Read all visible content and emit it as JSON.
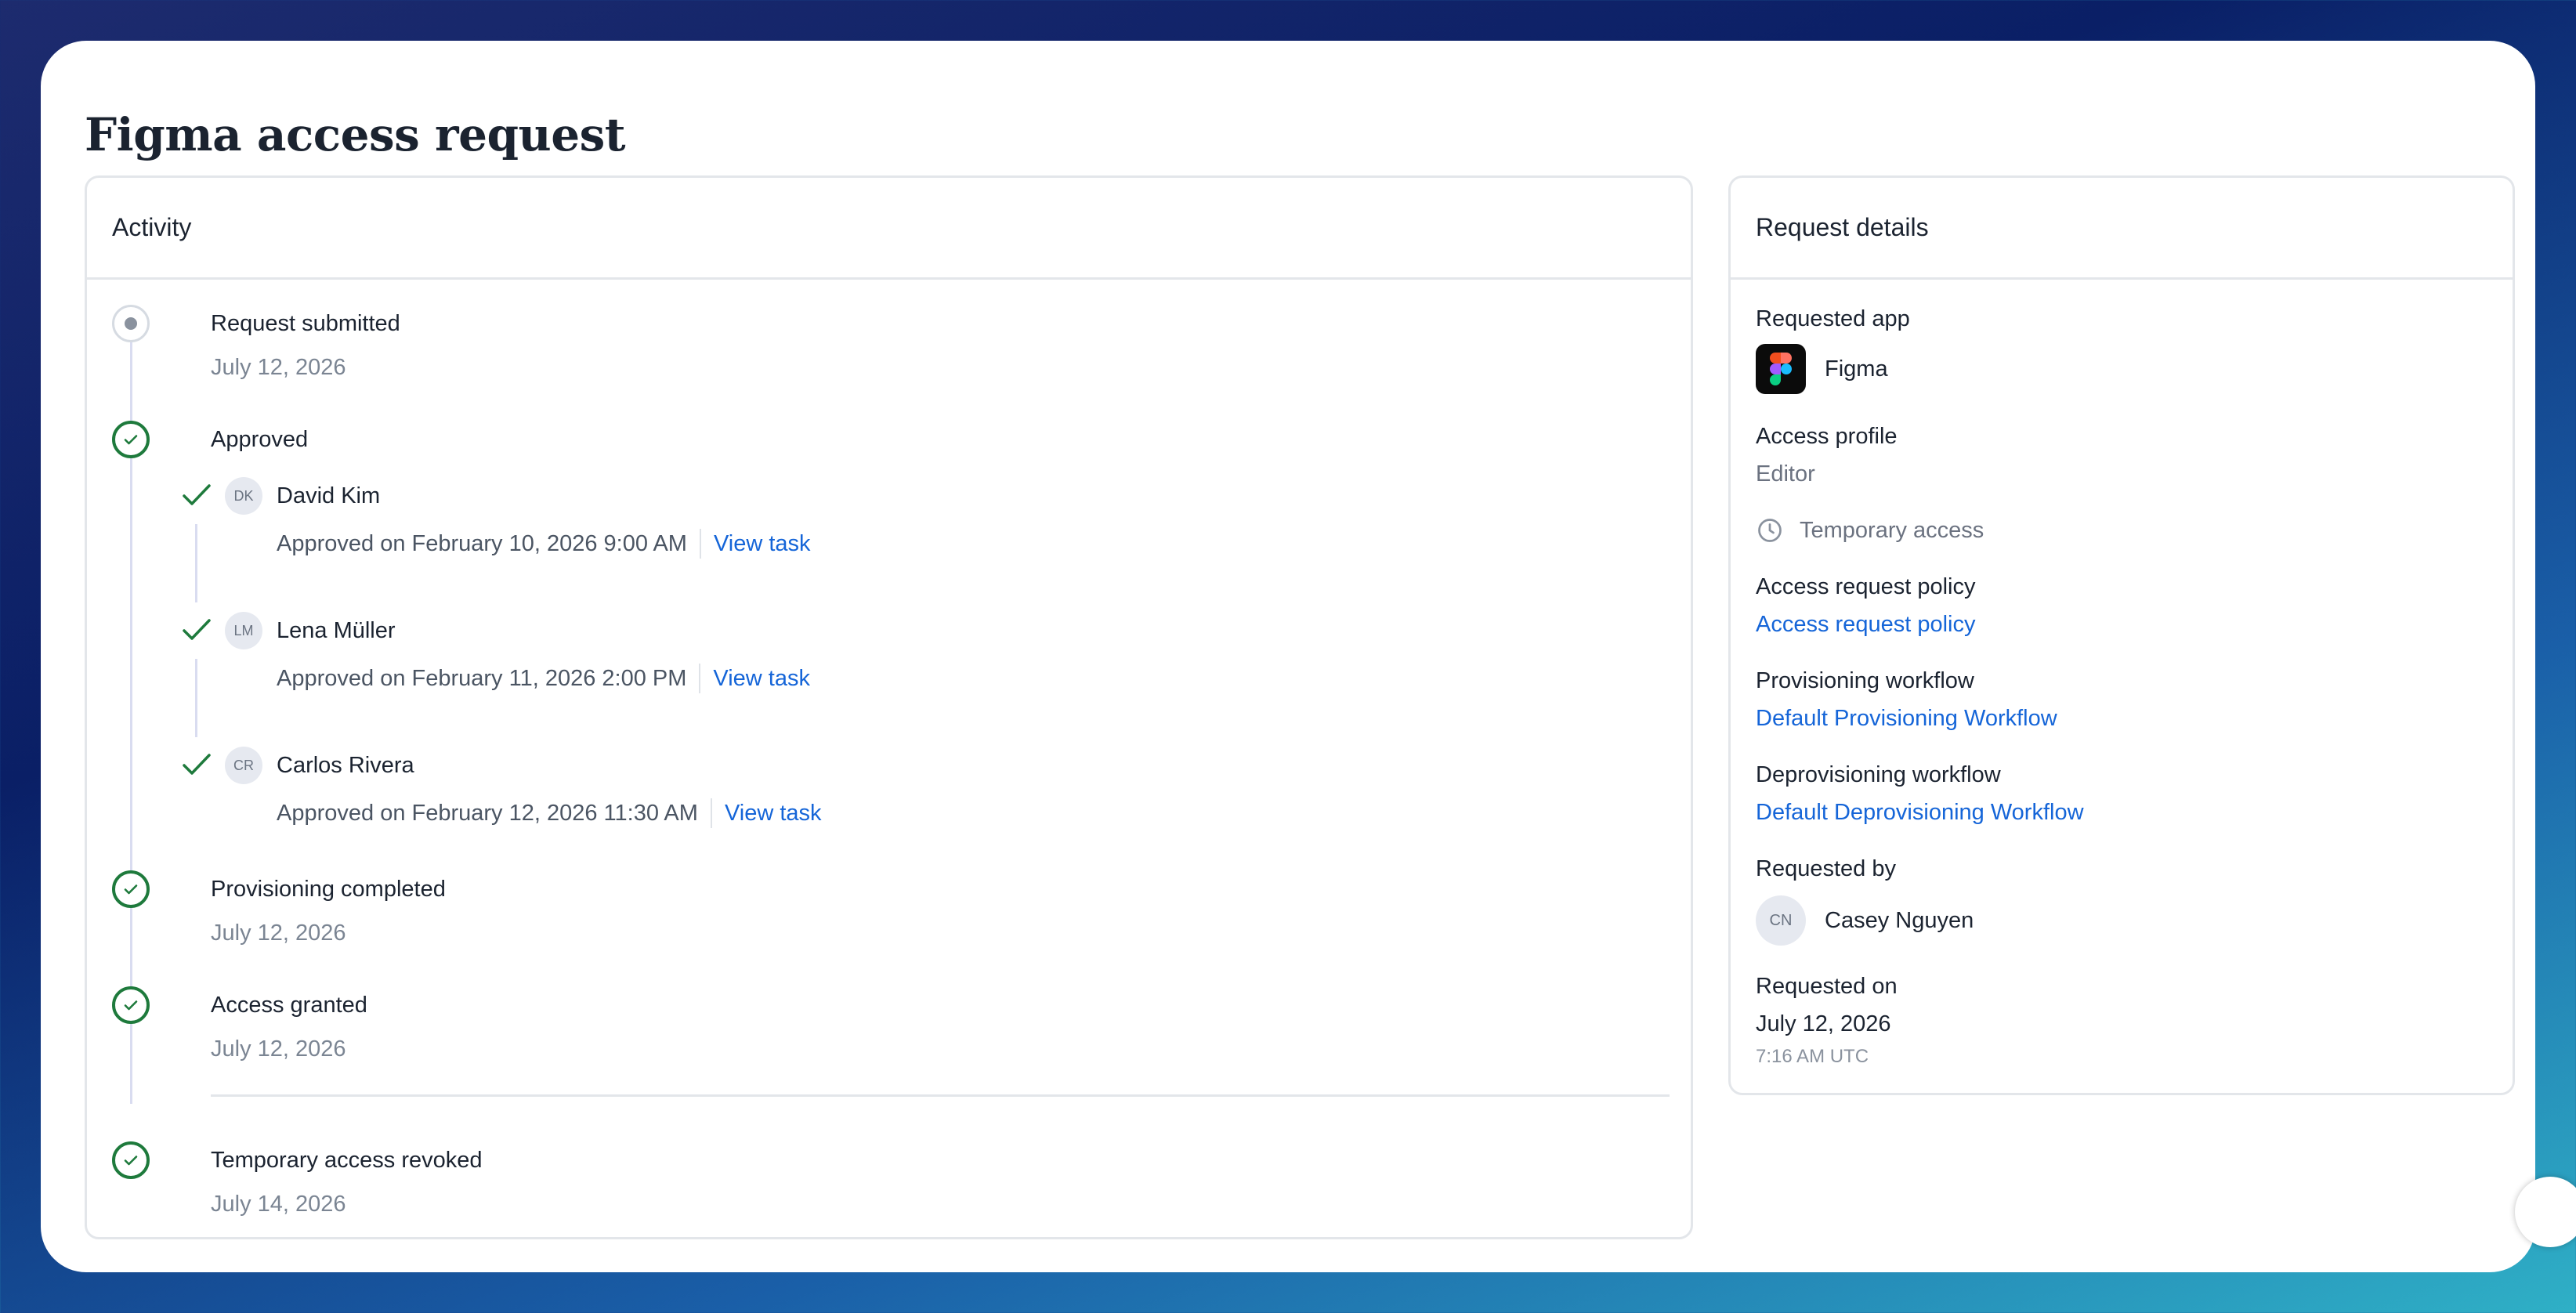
{
  "page": {
    "title": "Figma access request"
  },
  "activity": {
    "header": "Activity",
    "events": [
      {
        "title": "Request submitted",
        "date": "July 12, 2026",
        "status": "pending"
      },
      {
        "title": "Approved",
        "status": "done"
      },
      {
        "title": "Provisioning completed",
        "date": "July 12, 2026",
        "status": "done"
      },
      {
        "title": "Access granted",
        "date": "July 12, 2026",
        "status": "done"
      },
      {
        "title": "Temporary access revoked",
        "date": "July 14, 2026",
        "status": "done"
      }
    ],
    "approvers": [
      {
        "initials": "DK",
        "name": "David Kim",
        "detail": "Approved on February 10, 2026 9:00 AM",
        "link": "View task"
      },
      {
        "initials": "LM",
        "name": "Lena Müller",
        "detail": "Approved on February 11, 2026 2:00 PM",
        "link": "View task"
      },
      {
        "initials": "CR",
        "name": "Carlos Rivera",
        "detail": "Approved on February 12, 2026 11:30 AM",
        "link": "View task"
      }
    ]
  },
  "details": {
    "header": "Request details",
    "requested_app_label": "Requested app",
    "requested_app": "Figma",
    "access_profile_label": "Access profile",
    "access_profile": "Editor",
    "temporary_access": "Temporary access",
    "policy_label": "Access request policy",
    "policy_link": "Access request policy",
    "provisioning_label": "Provisioning workflow",
    "provisioning_link": "Default Provisioning Workflow",
    "deprovisioning_label": "Deprovisioning workflow",
    "deprovisioning_link": "Default Deprovisioning Workflow",
    "requested_by_label": "Requested by",
    "requested_by_initials": "CN",
    "requested_by": "Casey Nguyen",
    "requested_on_label": "Requested on",
    "requested_on_date": "July 12, 2026",
    "requested_on_time": "7:16 AM UTC"
  },
  "colors": {
    "success": "#1e7a3c",
    "link": "#1565d8",
    "timeline": "#d9dcf0"
  },
  "icons": [
    "check-circle-icon",
    "pending-dot-icon",
    "check-icon",
    "clock-icon",
    "figma-logo-icon"
  ]
}
